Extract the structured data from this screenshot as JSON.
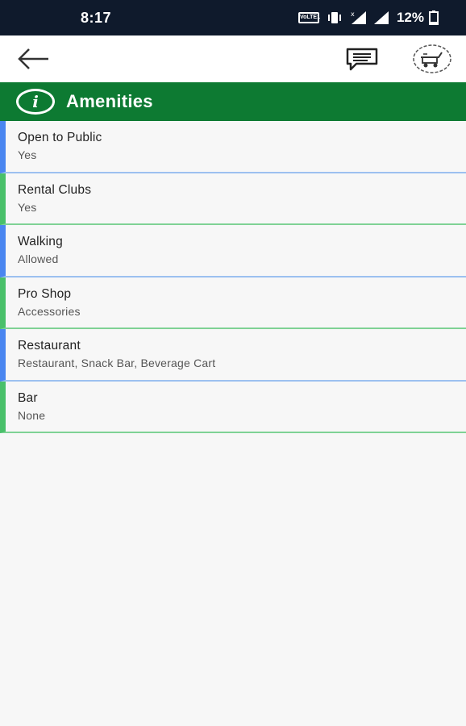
{
  "status_bar": {
    "time": "8:17",
    "volte_label": "VoLTE1",
    "battery_percent": "12%"
  },
  "app_bar": {
    "back_icon": "arrow-left-icon",
    "chat_icon": "chat-bubble-icon",
    "logo_icon": "golf-cart-logo-icon"
  },
  "section": {
    "icon": "info-icon",
    "icon_glyph": "i",
    "title": "Amenities",
    "color": "#0d7a32"
  },
  "amenities": [
    {
      "label": "Open to Public",
      "value": "Yes",
      "accent": "#4a86f0"
    },
    {
      "label": "Rental Clubs",
      "value": "Yes",
      "accent": "#49c06a"
    },
    {
      "label": "Walking",
      "value": "Allowed",
      "accent": "#4a86f0"
    },
    {
      "label": "Pro Shop",
      "value": "Accessories",
      "accent": "#49c06a"
    },
    {
      "label": "Restaurant",
      "value": "Restaurant, Snack Bar, Beverage Cart",
      "accent": "#4a86f0"
    },
    {
      "label": "Bar",
      "value": "None",
      "accent": "#49c06a"
    }
  ]
}
